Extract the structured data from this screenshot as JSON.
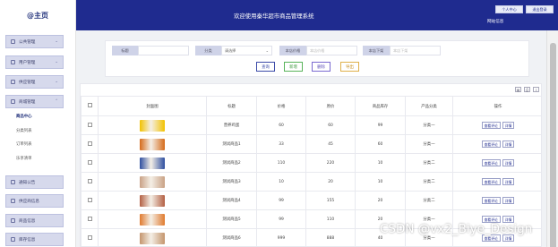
{
  "sidebar": {
    "logo": "@主页",
    "menus": [
      {
        "label": "公共管理"
      },
      {
        "label": "用户管理"
      },
      {
        "label": "供应管理"
      },
      {
        "label": "商城管理"
      }
    ],
    "submenu": [
      "商品中心",
      "分类列表",
      "订单列表",
      "乐享清单"
    ],
    "lower_menus": [
      {
        "label": "通知公告"
      },
      {
        "label": "供应商信息"
      },
      {
        "label": "商品信息"
      },
      {
        "label": "库存信息"
      }
    ]
  },
  "header": {
    "title": "欢迎使用秦华超市商品管理系统",
    "personal_center_label": "个人中心",
    "logout_label": "退出登录",
    "user_name": "网站信息"
  },
  "search": {
    "labels": [
      "标题",
      "分类",
      "本店价格",
      "本店下架"
    ],
    "category_value": "请选择",
    "min_price_placeholder": "本店价格",
    "max_price_placeholder": "本店下架",
    "buttons": {
      "query": "查询",
      "add": "新增",
      "delete": "删除",
      "export": "导出"
    }
  },
  "table": {
    "columns": [
      "封面图",
      "标题",
      "价格",
      "原价",
      "商品库存",
      "产品分类",
      "操作"
    ],
    "rows": [
      {
        "title": "营养鸡蛋",
        "price": "60",
        "original": "60",
        "stock": "99",
        "category": "分类一"
      },
      {
        "title": "测试商品1",
        "price": "33",
        "original": "45",
        "stock": "60",
        "category": "分类一"
      },
      {
        "title": "测试商品2",
        "price": "110",
        "original": "220",
        "stock": "10",
        "category": "分类二"
      },
      {
        "title": "测试商品3",
        "price": "10",
        "original": "20",
        "stock": "10",
        "category": "分类二"
      },
      {
        "title": "测试商品4",
        "price": "99",
        "original": "155",
        "stock": "20",
        "category": "分类二"
      },
      {
        "title": "测试商品5",
        "price": "99",
        "original": "110",
        "stock": "20",
        "category": "分类一"
      },
      {
        "title": "测试商品6",
        "price": "999",
        "original": "888",
        "stock": "40",
        "category": "分类一"
      }
    ],
    "op_labels": {
      "edit": "查看评论",
      "detail": "详情"
    },
    "thumb_colors": [
      "#f2c200",
      "#d56a1a",
      "#2f4fa0",
      "#c9a185",
      "#b35f43",
      "#e07a2e",
      "#c4956d"
    ]
  },
  "watermark": "CSDN @vx2_Biye_Design"
}
